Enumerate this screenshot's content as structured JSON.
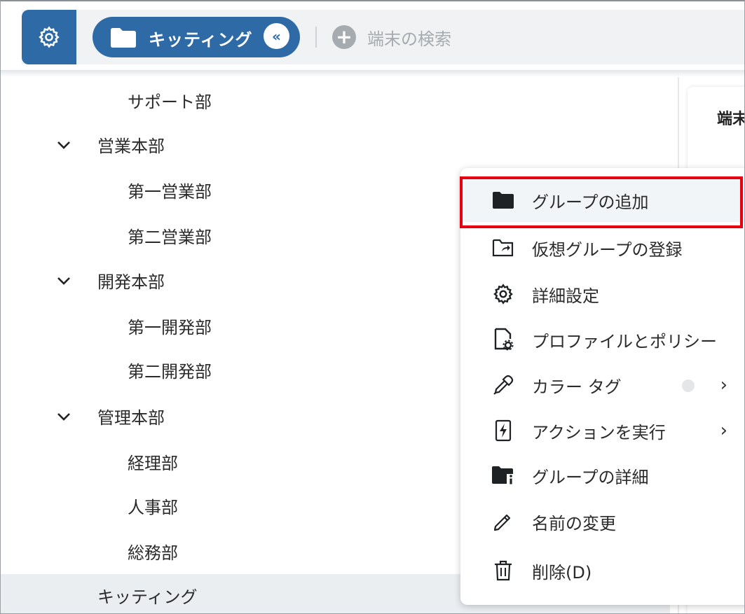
{
  "header": {
    "current_group": "キッティング",
    "collapse_glyph": "«",
    "search_placeholder": "端末の検索"
  },
  "tree": {
    "items": [
      {
        "label": "サポート部",
        "level": 2
      },
      {
        "label": "営業本部",
        "level": 1,
        "expanded": true
      },
      {
        "label": "第一営業部",
        "level": 2
      },
      {
        "label": "第二営業部",
        "level": 2
      },
      {
        "label": "開発本部",
        "level": 1,
        "expanded": true
      },
      {
        "label": "第一開発部",
        "level": 2
      },
      {
        "label": "第二開発部",
        "level": 2
      },
      {
        "label": "管理本部",
        "level": 1,
        "expanded": true
      },
      {
        "label": "経理部",
        "level": 2
      },
      {
        "label": "人事部",
        "level": 2
      },
      {
        "label": "総務部",
        "level": 2
      },
      {
        "label": "キッティング",
        "level": 1,
        "selected": true
      }
    ]
  },
  "right_panel": {
    "title": "端末"
  },
  "context_menu": {
    "items": [
      {
        "label": "グループの追加",
        "icon": "folder-icon",
        "highlighted": true
      },
      {
        "label": "仮想グループの登録",
        "icon": "folder-share-icon"
      },
      {
        "label": "詳細設定",
        "icon": "gear-icon"
      },
      {
        "label": "プロファイルとポリシー",
        "icon": "document-gear-icon"
      },
      {
        "label": "カラー タグ",
        "icon": "eyedropper-icon",
        "submenu": true
      },
      {
        "label": "アクションを実行",
        "icon": "lightning-icon",
        "submenu": true
      },
      {
        "label": "グループの詳細",
        "icon": "folder-info-icon"
      },
      {
        "label": "名前の変更",
        "icon": "pencil-icon"
      },
      {
        "label": "削除(D)",
        "icon": "trash-icon"
      }
    ],
    "submenu_arrow": "›"
  },
  "colors": {
    "brand": "#2d6aa6",
    "highlight_border": "#e60012",
    "selected_row": "#ebeef1"
  }
}
